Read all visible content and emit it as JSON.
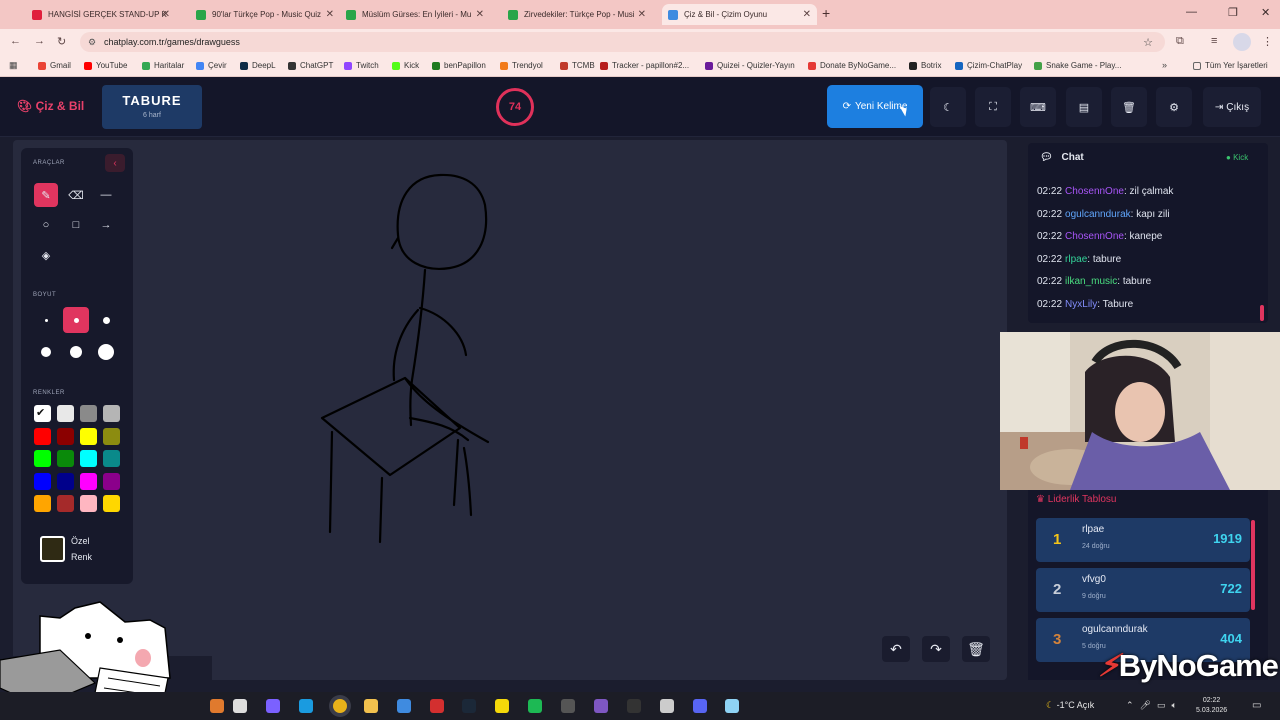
{
  "browser": {
    "tabs": [
      {
        "label": "HANGİSİ GERÇEK STAND-UP K",
        "color": "#e01e3c",
        "active": false
      },
      {
        "label": "90'lar Türkçe Pop - Music Quiz",
        "color": "#2aa54a",
        "active": false
      },
      {
        "label": "Müslüm Gürses: En İyileri - Mu",
        "color": "#2aa54a",
        "active": false
      },
      {
        "label": "Zirvedekiler: Türkçe Pop - Musi",
        "color": "#2aa54a",
        "active": false
      },
      {
        "label": "Çiz & Bil - Çizim Oyunu",
        "color": "#3f8be0",
        "active": true
      }
    ],
    "url": "chatplay.com.tr/games/drawguess",
    "bookmarks": [
      {
        "label": "Gmail",
        "color": "#ea4335"
      },
      {
        "label": "YouTube",
        "color": "#ff0000"
      },
      {
        "label": "Haritalar",
        "color": "#34a853"
      },
      {
        "label": "Çevir",
        "color": "#4285f4"
      },
      {
        "label": "DeepL",
        "color": "#0f2b46"
      },
      {
        "label": "ChatGPT",
        "color": "#333333"
      },
      {
        "label": "Twitch",
        "color": "#9146ff"
      },
      {
        "label": "Kick",
        "color": "#53fc18"
      },
      {
        "label": "benPapillon",
        "color": "#1f7a1f"
      },
      {
        "label": "Trendyol",
        "color": "#f27a1a"
      },
      {
        "label": "TCMB",
        "color": "#c0392b"
      },
      {
        "label": "Tracker - papillon#2...",
        "color": "#b71c1c"
      },
      {
        "label": "Quizei - Quizler-Yayın",
        "color": "#6a1b9a"
      },
      {
        "label": "Donate ByNoGame...",
        "color": "#e53935"
      },
      {
        "label": "Botrix",
        "color": "#222222"
      },
      {
        "label": "Çizim-ChatPlay",
        "color": "#1565c0"
      },
      {
        "label": "Snake Game - Play...",
        "color": "#43a047"
      }
    ],
    "all_bookmarks_label": "Tüm Yer İşaretleri"
  },
  "header": {
    "logo": "Çiz & Bil",
    "word": "TABURE",
    "word_hint": "6 harf",
    "timer": "74",
    "new_word_label": "Yeni Kelime",
    "exit_label": "Çıkış"
  },
  "tools": {
    "section_tools": "ARAÇLAR",
    "section_size": "BOYUT",
    "section_colors": "RENKLER",
    "custom_color_label_1": "Özel",
    "custom_color_label_2": "Renk",
    "colors": [
      "#ffffff",
      "#e8e8e8",
      "#8a8a8a",
      "#b5b5b5",
      "#ff0000",
      "#8b0000",
      "#ffff00",
      "#8c8c10",
      "#00ff00",
      "#0a8a0a",
      "#00ffff",
      "#0a8a8a",
      "#0000ff",
      "#00008b",
      "#ff00ff",
      "#8b008b",
      "#ffa500",
      "#a52a2a",
      "#ffb6c1",
      "#ffd700"
    ]
  },
  "chat": {
    "title": "Chat",
    "platform": "Kick",
    "messages": [
      {
        "time": "02:22",
        "user": "ChosennOne",
        "color": "#a855f7",
        "text": ": zil çalmak"
      },
      {
        "time": "02:22",
        "user": "ogulcanndurak",
        "color": "#60a5fa",
        "text": ": kapı zili"
      },
      {
        "time": "02:22",
        "user": "ChosennOne",
        "color": "#a855f7",
        "text": ": kanepe"
      },
      {
        "time": "02:22",
        "user": "rlpae",
        "color": "#34d399",
        "text": ": tabure"
      },
      {
        "time": "02:22",
        "user": "ilkan_music",
        "color": "#4ade80",
        "text": ": tabure"
      },
      {
        "time": "02:22",
        "user": "NyxLily",
        "color": "#818cf8",
        "text": ": Tabure"
      }
    ]
  },
  "leaderboard": {
    "title": "Liderlik Tablosu",
    "rows": [
      {
        "rank": "1",
        "name": "rlpae",
        "detail": "24 doğru",
        "score": "1919",
        "color": "#f5c518"
      },
      {
        "rank": "2",
        "name": "vfvg0",
        "detail": "9 doğru",
        "score": "722",
        "color": "#c7cdd8"
      },
      {
        "rank": "3",
        "name": "ogulcanndurak",
        "detail": "5 doğru",
        "score": "404",
        "color": "#d4833b"
      }
    ]
  },
  "watermark": "ByNoGame",
  "taskbar": {
    "weather": "-1°C  Açık",
    "time": "02:22",
    "date": "5.03.2026"
  }
}
